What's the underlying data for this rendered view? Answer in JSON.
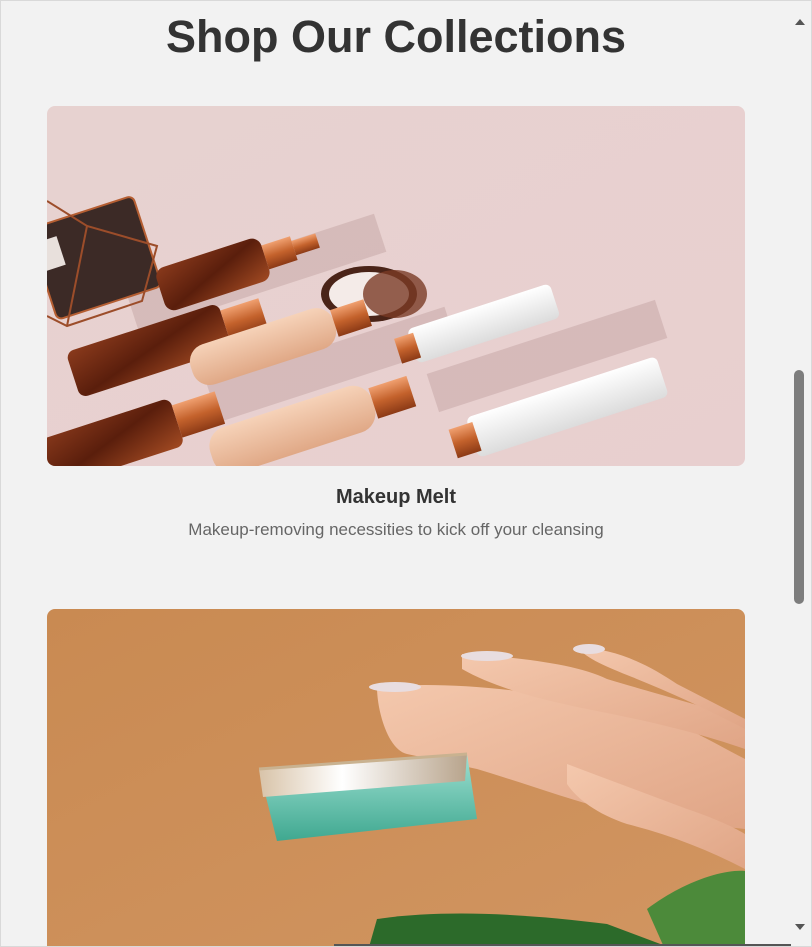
{
  "page": {
    "title": "Shop Our Collections"
  },
  "collections": [
    {
      "title": "Makeup Melt",
      "description": "Makeup-removing necessities to kick off your cleansing",
      "image_icon": "cosmetic-bottles-photo"
    },
    {
      "title": "",
      "description": "",
      "image_icon": "hand-holding-jar-photo"
    }
  ],
  "colors": {
    "background": "#f2f2f2",
    "title_text": "#333333",
    "description_text": "#666666",
    "card1_backdrop": "#e6cccc",
    "card2_backdrop": "#c98a52",
    "scroll_thumb": "#7d7d7d"
  }
}
